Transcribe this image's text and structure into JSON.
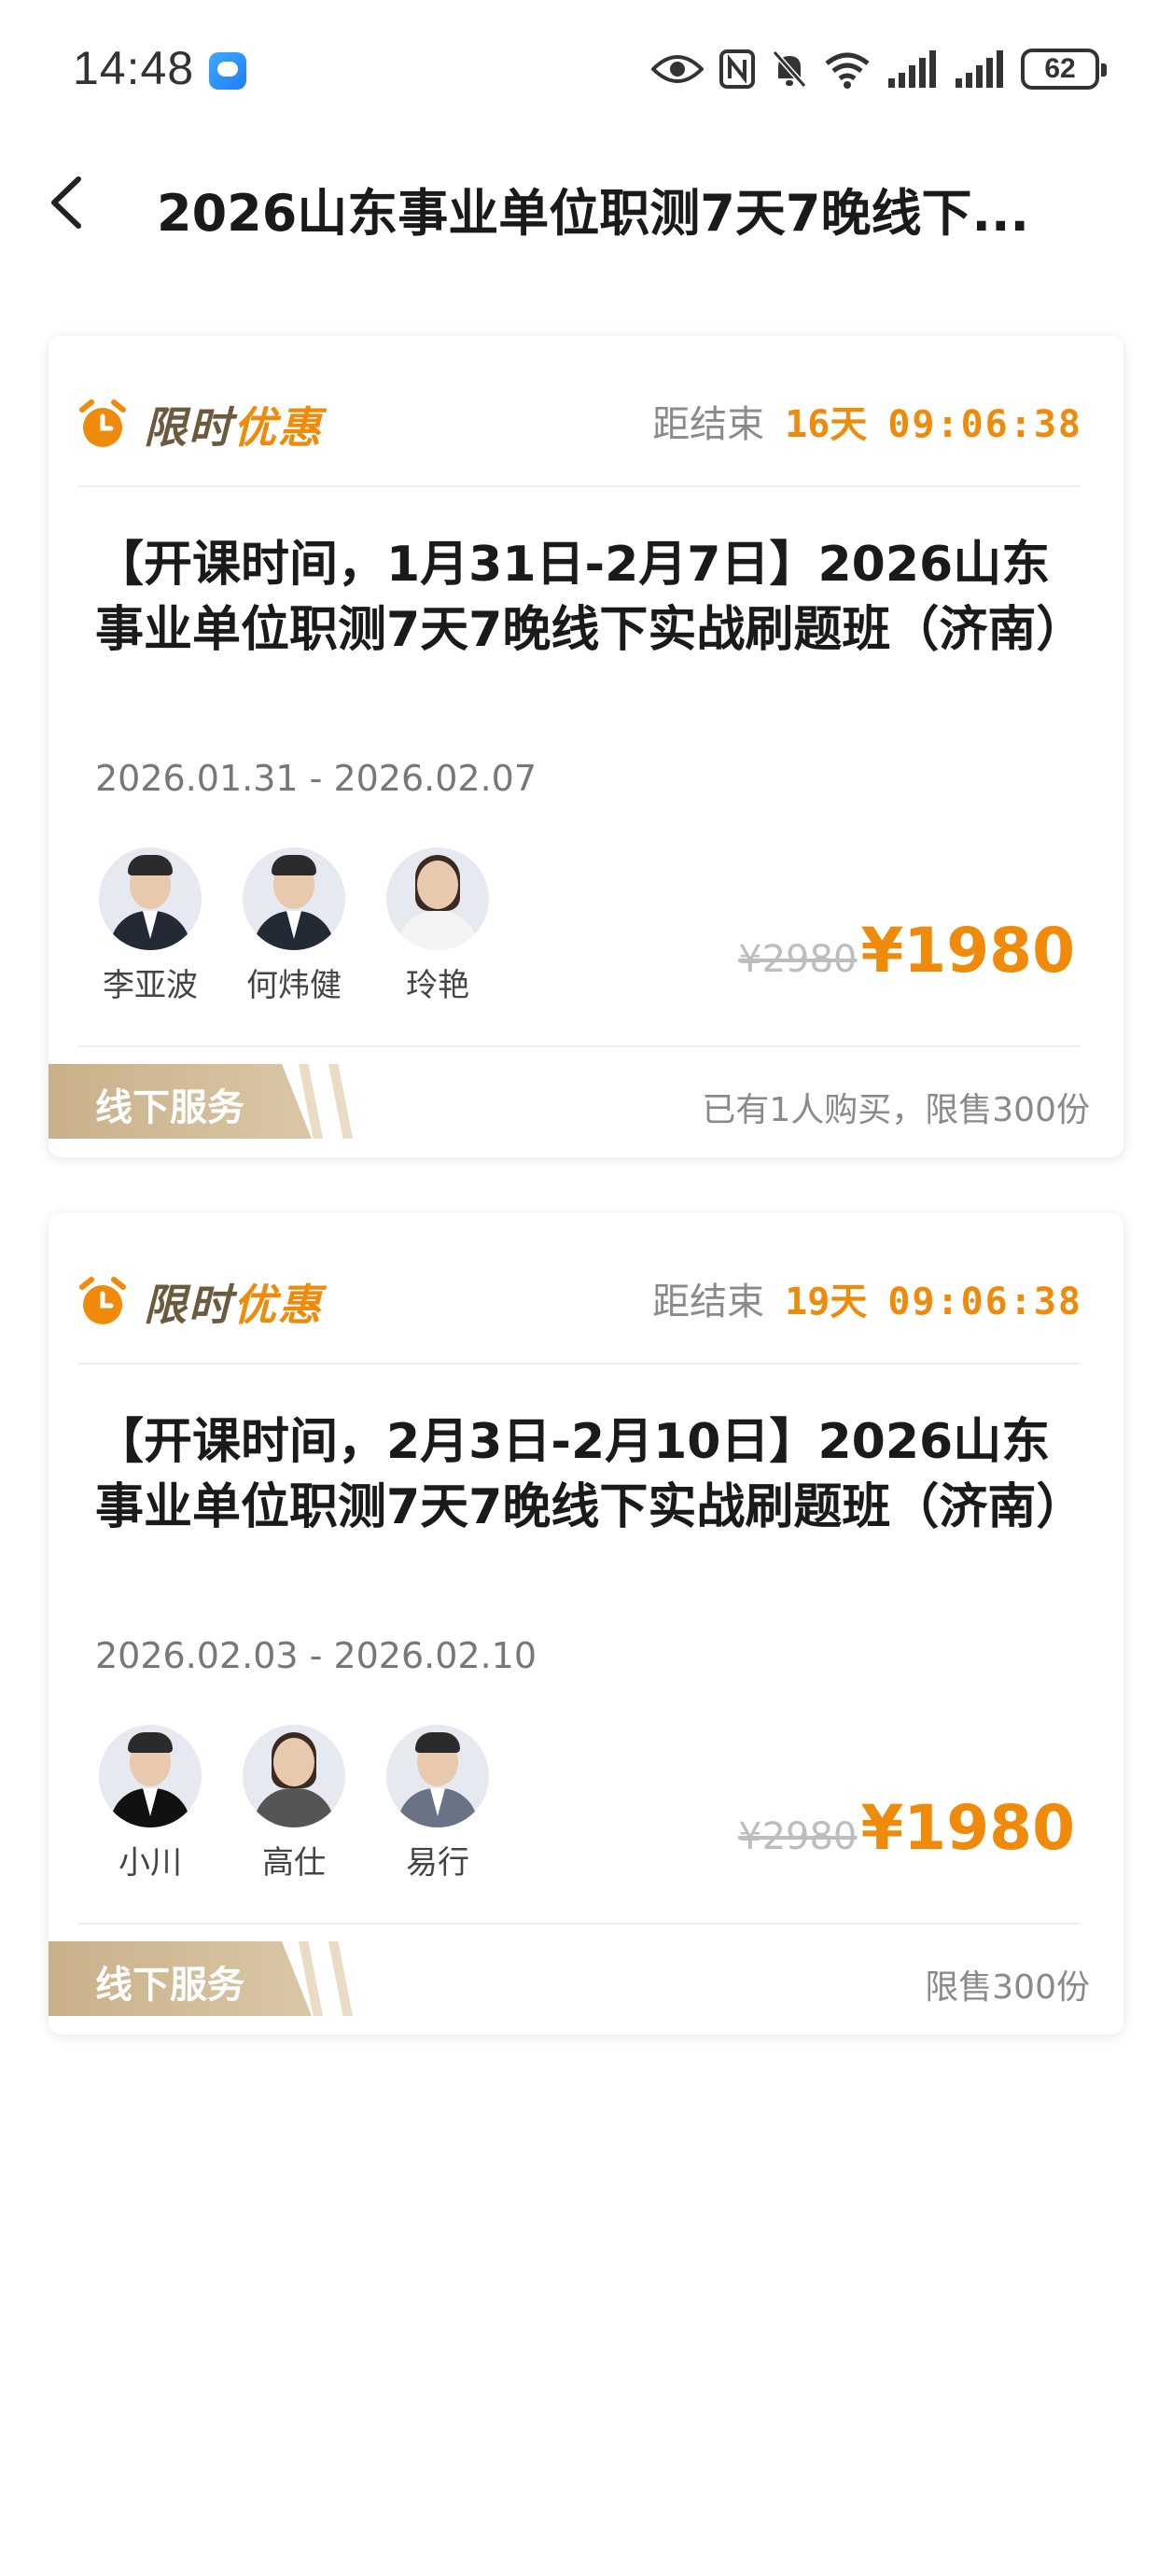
{
  "status_bar": {
    "time": "14:48",
    "battery": "62"
  },
  "nav": {
    "title": "2026山东事业单位职测7天7晚线下..."
  },
  "courses": [
    {
      "promo_a": "限时",
      "promo_b": "优惠",
      "countdown_label": "距结束",
      "countdown_days": "16天",
      "countdown_time": "09:06:38",
      "title": "【开课时间，1月31日-2月7日】2026山东事业单位职测7天7晚线下实战刷题班（济南）",
      "dates": "2026.01.31 - 2026.02.07",
      "teachers": [
        {
          "name": "李亚波"
        },
        {
          "name": "何炜健"
        },
        {
          "name": "玲艳"
        }
      ],
      "old_price": "¥2980",
      "new_price": "¥1980",
      "service": "线下服务",
      "sales": "已有1人购买，限售300份"
    },
    {
      "promo_a": "限时",
      "promo_b": "优惠",
      "countdown_label": "距结束",
      "countdown_days": "19天",
      "countdown_time": "09:06:38",
      "title": "【开课时间，2月3日-2月10日】2026山东事业单位职测7天7晚线下实战刷题班（济南）",
      "dates": "2026.02.03 - 2026.02.10",
      "teachers": [
        {
          "name": "小川"
        },
        {
          "name": "高仕"
        },
        {
          "name": "易行"
        }
      ],
      "old_price": "¥2980",
      "new_price": "¥1980",
      "service": "线下服务",
      "sales": "限售300份"
    }
  ],
  "colors": {
    "accent": "#ef8a0b",
    "gold": "#c9b08a"
  }
}
